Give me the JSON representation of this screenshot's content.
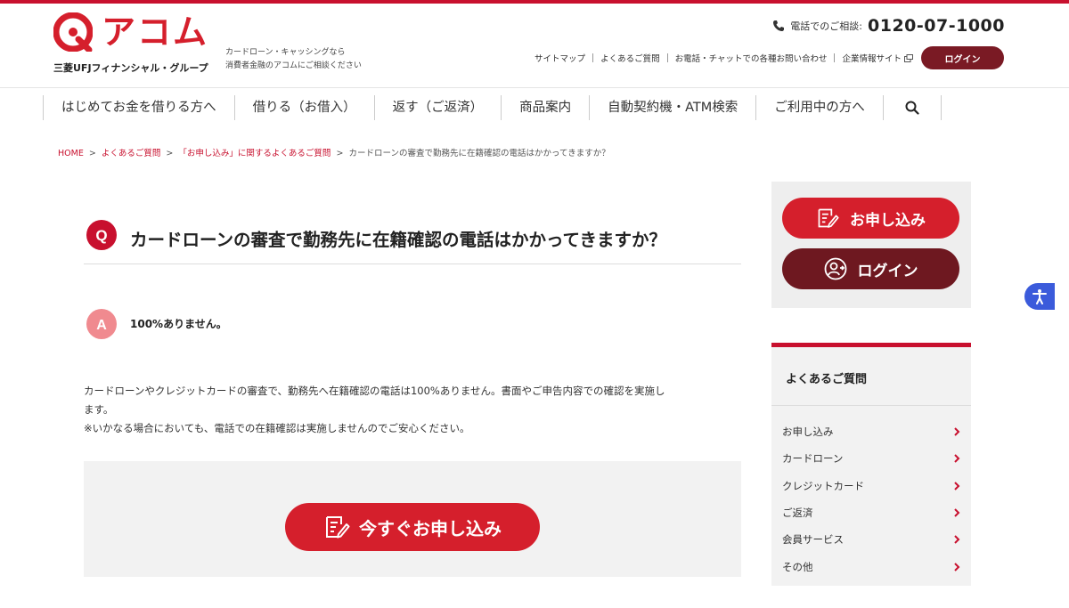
{
  "header": {
    "brand": "アコム",
    "group": "三菱UFJフィナンシャル・グループ",
    "tagline_line1": "カードローン・キャッシングなら",
    "tagline_line2": "消費者金融のアコムにご相談ください",
    "phone_label": "電話でのご相談:",
    "phone_number": "0120-07-1000",
    "util_links": [
      "サイトマップ",
      "よくあるご質問",
      "お電話・チャットでの各種お問い合わせ",
      "企業情報サイト"
    ],
    "login_label": "ログイン"
  },
  "nav": {
    "items": [
      "はじめてお金を借りる方へ",
      "借りる（お借入）",
      "返す（ご返済）",
      "商品案内",
      "自動契約機・ATM検索",
      "ご利用中の方へ"
    ]
  },
  "breadcrumb": {
    "home": "HOME",
    "faq": "よくあるご質問",
    "category": "「お申し込み」に関するよくあるご質問",
    "current": "カードローンの審査で勤務先に在籍確認の電話はかかってきますか？",
    "separator": ">"
  },
  "qa": {
    "q_mark": "Q",
    "question": "カードローンの審査で勤務先に在籍確認の電話はかかってきますか？",
    "a_mark": "A",
    "answer": "100%ありません。",
    "body_line1": "カードローンやクレジットカードの審査で、勤務先へ在籍確認の電話は100%ありません。書面やご申告内容での確認を実施し",
    "body_line2": "ます。",
    "body_line3": "※いかなる場合においても、電話での在籍確認は実施しませんのでご安心ください。",
    "cta_label": "今すぐお申し込み"
  },
  "sidebar": {
    "apply_label": "お申し込み",
    "login_label": "ログイン",
    "faq_title": "よくあるご質問",
    "faq_items": [
      "お申し込み",
      "カードローン",
      "クレジットカード",
      "ご返済",
      "会員サービス",
      "その他"
    ]
  },
  "colors": {
    "brand_red": "#d51f2c",
    "dark_red": "#6e1820",
    "accessibility_blue": "#3b5bdb"
  },
  "icons": [
    "phone-icon",
    "external-link-icon",
    "search-icon",
    "application-form-icon",
    "user-login-icon",
    "chevron-right-icon",
    "accessibility-icon"
  ]
}
